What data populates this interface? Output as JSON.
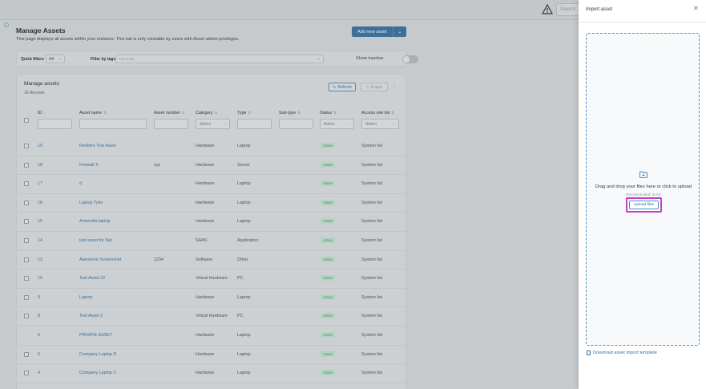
{
  "topbar": {
    "search_placeholder": "Search"
  },
  "page": {
    "title": "Manage Assets",
    "description": "This page displays all assets within your instance. This tab is only viewable by users with Asset admin privileges.",
    "add_button": "Add new asset"
  },
  "filters": {
    "quick_label": "Quick filters",
    "quick_value": "All",
    "tags_label": "Filter by tags",
    "tags_placeholder": "Add a tag",
    "show_inactive": "Show inactive"
  },
  "card": {
    "title": "Manage assets",
    "subtitle": "16 Records",
    "refresh": "Refresh",
    "export": "Export",
    "columns": {
      "id": "ID",
      "name": "Asset name",
      "number": "Asset number",
      "category": "Category",
      "type": "Type",
      "subtype": "Sub-type",
      "status": "Status",
      "access": "Access role list"
    },
    "category_filter": "Select",
    "status_filter": "Active",
    "access_filter": "Select"
  },
  "rows": [
    {
      "id": "19",
      "name": "Redwire Test Asset",
      "number": "",
      "category": "Hardware",
      "type": "Laptop",
      "status": "Active",
      "access": "System list",
      "check": true
    },
    {
      "id": "18",
      "name": "Firewall X",
      "number": "xyz",
      "category": "Hardware",
      "type": "Server",
      "status": "Active",
      "access": "System list",
      "check": true
    },
    {
      "id": "17",
      "name": "d",
      "number": "",
      "category": "Hardware",
      "type": "Laptop",
      "status": "Active",
      "access": "System list",
      "check": true
    },
    {
      "id": "16",
      "name": "Laptop Tyler",
      "number": "",
      "category": "Hardware",
      "type": "Laptop",
      "status": "Active",
      "access": "System list",
      "check": true
    },
    {
      "id": "15",
      "name": "Antonella laptop",
      "number": "",
      "category": "Hardware",
      "type": "Laptop",
      "status": "Active",
      "access": "System list",
      "check": true
    },
    {
      "id": "14",
      "name": "test asset for Nat",
      "number": "",
      "category": "SAAS",
      "type": "Application",
      "status": "Active",
      "access": "System list",
      "check": true
    },
    {
      "id": "13",
      "name": "Awesome Screenshot",
      "number": "1234",
      "category": "Software",
      "type": "Other",
      "status": "Active",
      "access": "System list",
      "check": true
    },
    {
      "id": "10",
      "name": "Test Asset 22",
      "number": "",
      "category": "Virtual Hardware",
      "type": "PC",
      "status": "Active",
      "access": "System list",
      "check": true
    },
    {
      "id": "9",
      "name": "Laptop",
      "number": "",
      "category": "Hardware",
      "type": "Laptop",
      "status": "Active",
      "access": "System list",
      "check": true
    },
    {
      "id": "8",
      "name": "Test Asset 2",
      "number": "",
      "category": "Virtual Hardware",
      "type": "PC",
      "status": "Active",
      "access": "System list",
      "check": true
    },
    {
      "id": "6",
      "name": "PRIVATE ASSET",
      "number": "",
      "category": "Hardware",
      "type": "Laptop",
      "status": "Active",
      "access": "System list",
      "check": false
    },
    {
      "id": "5",
      "name": "Company Laptop D",
      "number": "",
      "category": "Hardware",
      "type": "Laptop",
      "status": "Active",
      "access": "System list",
      "check": true
    },
    {
      "id": "4",
      "name": "Company Laptop C",
      "number": "",
      "category": "Hardware",
      "type": "Laptop",
      "status": "Active",
      "access": "System list",
      "check": true
    }
  ],
  "drawer": {
    "title": "Import asset",
    "drop_text": "Drag and drop your files here or click to upload",
    "recommended": "Recommended: XLSX",
    "upload_button": "Upload files",
    "download_template": "Download asset import template"
  },
  "colors": {
    "accent": "#3d6f98",
    "highlight": "#c43ec8",
    "dropzone_border": "#4a8fc2"
  }
}
